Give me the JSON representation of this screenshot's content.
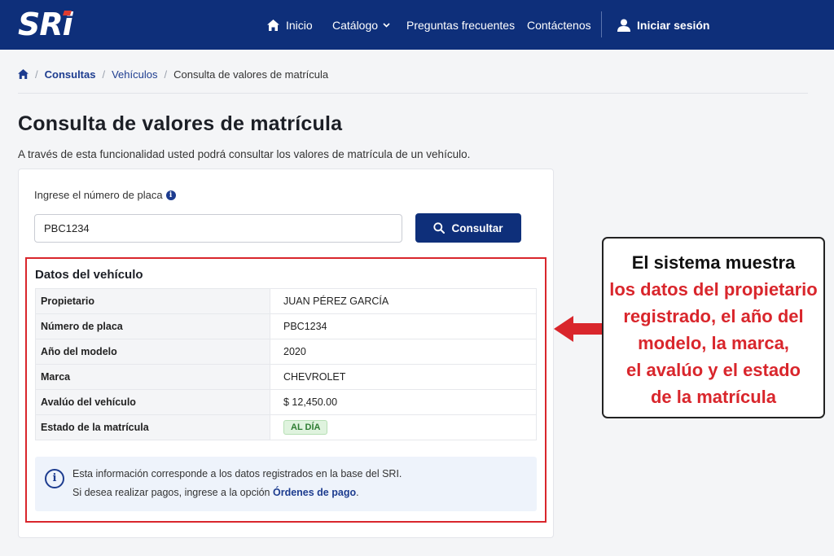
{
  "header": {
    "logo_text": "SRi",
    "nav": [
      {
        "label": "Inicio",
        "icon": "home-icon"
      },
      {
        "label": "Catálogo",
        "icon": "chevron-down-icon"
      },
      {
        "label": "Preguntas frecuentes"
      },
      {
        "label": "Contáctenos"
      },
      {
        "label": "Iniciar sesión",
        "icon": "user-icon"
      }
    ]
  },
  "breadcrumb": {
    "items": [
      "Consultas",
      "Vehículos"
    ],
    "current": "Consulta de valores de matrícula",
    "separator": "/"
  },
  "page": {
    "title": "Consulta de valores de matrícula",
    "description": "A través de esta funcionalidad usted podrá consultar los valores de matrícula de un vehículo."
  },
  "form": {
    "label": "Ingrese el número de placa",
    "value": "PBC1234",
    "button_label": "Consultar"
  },
  "vehicle": {
    "section_title": "Datos del vehículo",
    "rows": [
      {
        "key": "Propietario",
        "value": "JUAN PÉREZ GARCÍA"
      },
      {
        "key": "Número de placa",
        "value": "PBC1234"
      },
      {
        "key": "Año del modelo",
        "value": "2020"
      },
      {
        "key": "Marca",
        "value": "CHEVROLET"
      },
      {
        "key": "Avalúo del vehículo",
        "value": "$ 12,450.00"
      },
      {
        "key": "Estado de la matrícula",
        "value": "AL DÍA"
      }
    ]
  },
  "notice": {
    "line1": "Esta información corresponde a los datos registrados en la base del SRI.",
    "line2_prefix": "Si desea realizar pagos, ingrese a la opción ",
    "line2_link": "Órdenes de pago",
    "line2_suffix": "."
  },
  "callout": {
    "line1": "El sistema muestra",
    "line2": "los datos del propietario",
    "line3": "registrado, el año del",
    "line4": "modelo, la marca,",
    "line5": "el avalúo y el estado",
    "line6": "de la matrícula"
  },
  "colors": {
    "header_bg": "#0e2f7a",
    "accent_red": "#d9262c",
    "link_blue": "#1d3c8f",
    "status_green": "#2e7d32"
  }
}
